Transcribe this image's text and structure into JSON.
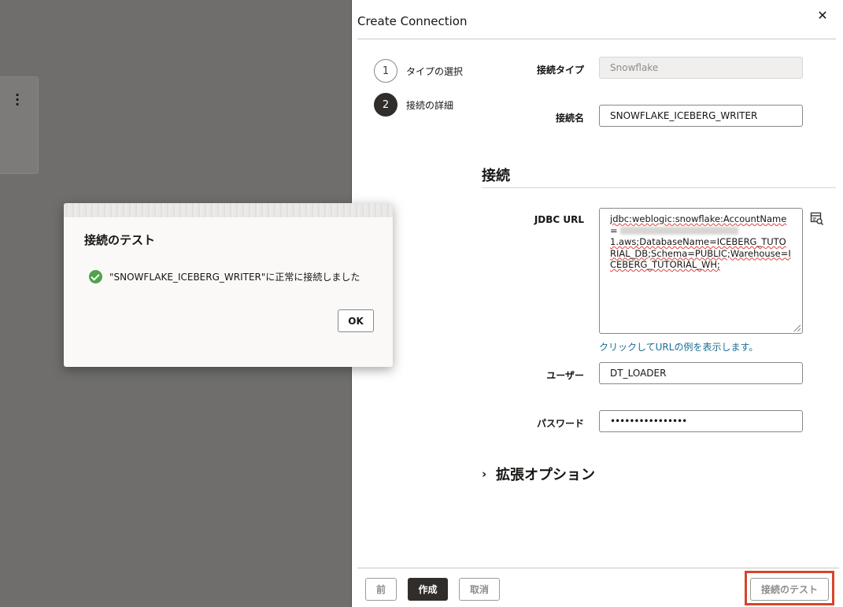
{
  "drawer": {
    "title": "Create Connection",
    "steps": [
      {
        "number": "1",
        "label": "タイプの選択"
      },
      {
        "number": "2",
        "label": "接続の詳細"
      }
    ],
    "fields": {
      "type_label": "接続タイプ",
      "type_value": "Snowflake",
      "name_label": "接続名",
      "name_value": "SNOWFLAKE_ICEBERG_WRITER",
      "section_title": "接続",
      "jdbc_label": "JDBC URL",
      "jdbc_line1": "jdbc:weblogic:snowflake:AccountName",
      "jdbc_line2_prefix": "=",
      "jdbc_rest": "1.aws;DatabaseName=ICEBERG_TUTORIAL_DB;Schema=PUBLIC;Warehouse=ICEBERG_TUTORIAL_WH;",
      "jdbc_example_link": "クリックしてURLの例を表示します。",
      "user_label": "ユーザー",
      "user_value": "DT_LOADER",
      "password_label": "パスワード",
      "password_value": "••••••••••••••••",
      "advanced_options": "拡張オプション"
    },
    "footer": {
      "back": "前",
      "create": "作成",
      "cancel": "取消",
      "test": "接続のテスト"
    }
  },
  "dialog": {
    "title": "接続のテスト",
    "message": "\"SNOWFLAKE_ICEBERG_WRITER\"に正常に接続しました",
    "ok": "OK"
  },
  "icons": {
    "close": "close-icon",
    "kebab": "kebab-menu-icon",
    "lookup": "lookup-icon",
    "success": "success-check-icon",
    "chevron": "chevron-right-icon"
  },
  "colors": {
    "primary_button": "#312d2a",
    "success": "#50a34b",
    "link": "#1c6d94",
    "highlight": "#d6452b"
  }
}
